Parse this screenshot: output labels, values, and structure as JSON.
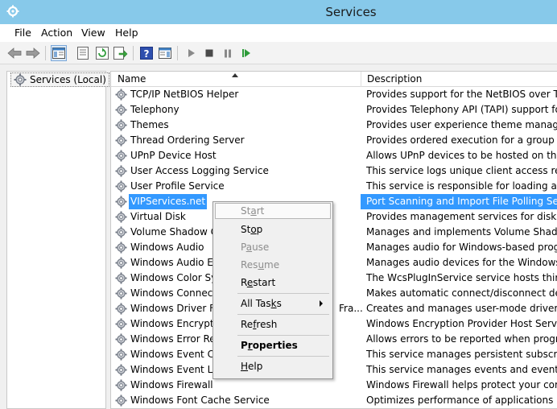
{
  "window": {
    "title": "Services"
  },
  "menubar": {
    "items": [
      {
        "label": "File"
      },
      {
        "label": "Action"
      },
      {
        "label": "View"
      },
      {
        "label": "Help"
      }
    ]
  },
  "toolbar": {
    "buttons": [
      "back-icon",
      "forward-icon",
      "show-hide-console-tree-icon",
      "properties-icon",
      "refresh-icon",
      "export-list-icon",
      "help-icon",
      "show-action-pane-icon",
      "start-service-icon",
      "stop-service-icon",
      "pause-service-icon",
      "restart-service-icon"
    ]
  },
  "tree": {
    "root_label": "Services (Local)"
  },
  "list": {
    "columns": {
      "name": "Name",
      "description": "Description"
    },
    "rows": [
      {
        "name": "TCP/IP NetBIOS Helper",
        "description": "Provides support for the NetBIOS over TCP/IP"
      },
      {
        "name": "Telephony",
        "description": "Provides Telephony API (TAPI) support for pr"
      },
      {
        "name": "Themes",
        "description": "Provides user experience theme management"
      },
      {
        "name": "Thread Ordering Server",
        "description": "Provides ordered execution for a group of thr"
      },
      {
        "name": "UPnP Device Host",
        "description": "Allows UPnP devices to be hosted on this com"
      },
      {
        "name": "User Access Logging Service",
        "description": "This service logs unique client access request"
      },
      {
        "name": "User Profile Service",
        "description": "This service is responsible for loading and unl"
      },
      {
        "name": "VIPServices.net",
        "description": "Port Scanning and Import File Polling Service"
      },
      {
        "name": "Virtual Disk",
        "description": "Provides management services for disks, volu"
      },
      {
        "name": "Volume Shadow Co",
        "description": "Manages and implements Volume Shadow C"
      },
      {
        "name": "Windows Audio",
        "description": "Manages audio for Windows-based programs"
      },
      {
        "name": "Windows Audio End",
        "description": "Manages audio devices for the Windows Aud"
      },
      {
        "name": "Windows Color Syst",
        "description": "The WcsPlugInService service hosts third-part"
      },
      {
        "name": "Windows Connection",
        "description": "Makes automatic connect/disconnect decisio"
      },
      {
        "name": "Windows Driver Fou",
        "extra": "Fra...",
        "description": "Creates and manages user-mode driver proce"
      },
      {
        "name": "Windows Encryption",
        "description": "Windows Encryption Provider Host Service br"
      },
      {
        "name": "Windows Error Repo",
        "description": "Allows errors to be reported when programs s"
      },
      {
        "name": "Windows Event Coll",
        "description": "This service manages persistent subscriptions"
      },
      {
        "name": "Windows Event Log",
        "description": "This service manages events and event logs. I"
      },
      {
        "name": "Windows Firewall",
        "description": "Windows Firewall helps protect your compute"
      },
      {
        "name": "Windows Font Cache Service",
        "description": "Optimizes performance of applications by cac"
      }
    ],
    "selected_index": 7
  },
  "context_menu": {
    "start_a": "St",
    "start_b": "a",
    "start_c": "rt",
    "stop_a": "St",
    "stop_b": "o",
    "stop_c": "p",
    "pause_a": "P",
    "pause_b": "a",
    "pause_c": "use",
    "resume_a": "Res",
    "resume_b": "u",
    "resume_c": "me",
    "restart_a": "R",
    "restart_b": "e",
    "restart_c": "start",
    "alltasks_a": "All Tas",
    "alltasks_b": "k",
    "alltasks_c": "s",
    "refresh_a": "Re",
    "refresh_b": "f",
    "refresh_c": "resh",
    "properties_a": "P",
    "properties_b": "r",
    "properties_c": "operties",
    "help_a": "",
    "help_b": "H",
    "help_c": "elp"
  },
  "colors": {
    "titlebar": "#87c9ea",
    "selection": "#3399ff"
  }
}
